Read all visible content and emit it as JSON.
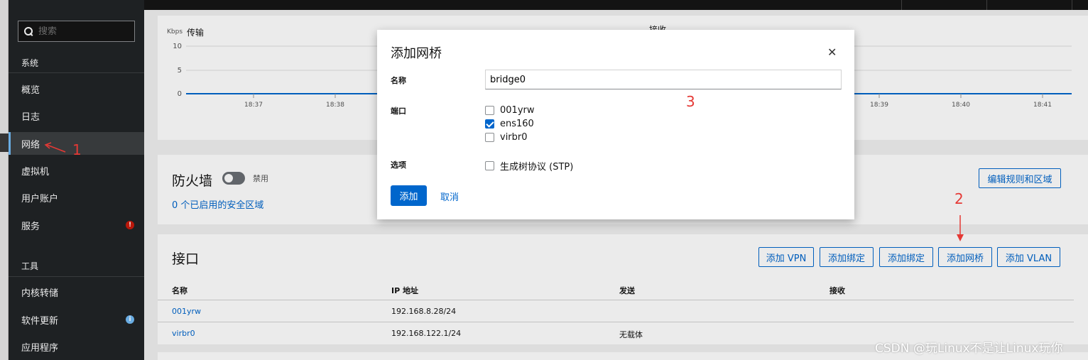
{
  "sidebar": {
    "search_placeholder": "搜索",
    "section_system": "系统",
    "items": [
      {
        "label": "概览"
      },
      {
        "label": "日志"
      },
      {
        "label": "网络"
      },
      {
        "label": "虚拟机"
      },
      {
        "label": "用户账户"
      },
      {
        "label": "服务",
        "badge": "!"
      }
    ],
    "section_tools": "工具",
    "tools": [
      {
        "label": "内核转储"
      },
      {
        "label": "软件更新",
        "badge": "i"
      },
      {
        "label": "应用程序"
      }
    ]
  },
  "chart": {
    "unit": "Kbps",
    "title": "传输",
    "title2": "接收",
    "y_ticks": [
      "10",
      "5",
      "0"
    ],
    "x_ticks": [
      "18:37",
      "18:38",
      "18:39",
      "18:40",
      "18:41"
    ]
  },
  "firewall": {
    "title": "防火墙",
    "toggle_label": "禁用",
    "zones_link": "0 个已启用的安全区域",
    "edit_button": "编辑规则和区域"
  },
  "interfaces": {
    "title": "接口",
    "buttons": [
      "添加 VPN",
      "添加绑定",
      "添加绑定",
      "添加网桥",
      "添加 VLAN"
    ],
    "columns": [
      "名称",
      "IP 地址",
      "发送",
      "接收"
    ],
    "rows": [
      {
        "name": "001yrw",
        "ip": "192.168.8.28/24",
        "send": "",
        "recv": ""
      },
      {
        "name": "virbr0",
        "ip": "192.168.122.1/24",
        "send": "无载体",
        "recv": ""
      }
    ]
  },
  "modal": {
    "title": "添加网桥",
    "name_label": "名称",
    "name_value": "bridge0",
    "ports_label": "端口",
    "ports": [
      {
        "label": "001yrw",
        "checked": false
      },
      {
        "label": "ens160",
        "checked": true
      },
      {
        "label": "virbr0",
        "checked": false
      }
    ],
    "options_label": "选项",
    "stp_label": "生成树协议 (STP)",
    "add_button": "添加",
    "cancel_button": "取消"
  },
  "annotations": {
    "one": "1",
    "two": "2",
    "three": "3"
  },
  "watermark": "CSDN @玩Linux不是让Linux玩你",
  "colors": {
    "accent": "#0066cc",
    "sidebar_bg": "#212427",
    "annotation": "#e53935"
  }
}
